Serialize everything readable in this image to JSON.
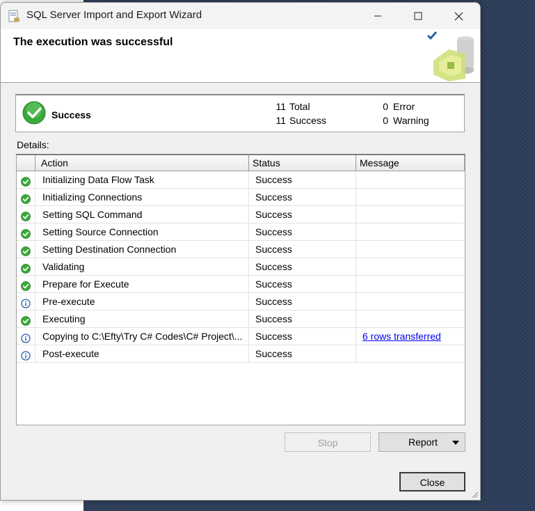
{
  "window": {
    "title": "SQL Server Import and Export Wizard"
  },
  "header": {
    "title": "The execution was successful"
  },
  "summary": {
    "status": "Success",
    "total_count": "11",
    "total_label": "Total",
    "success_count": "11",
    "success_label": "Success",
    "error_count": "0",
    "error_label": "Error",
    "warning_count": "0",
    "warning_label": "Warning"
  },
  "details_label": "Details:",
  "grid": {
    "columns": [
      "Action",
      "Status",
      "Message"
    ],
    "rows": [
      {
        "icon": "success-icon",
        "action": "Initializing Data Flow Task",
        "status": "Success",
        "message": ""
      },
      {
        "icon": "success-icon",
        "action": "Initializing Connections",
        "status": "Success",
        "message": ""
      },
      {
        "icon": "success-icon",
        "action": "Setting SQL Command",
        "status": "Success",
        "message": ""
      },
      {
        "icon": "success-icon",
        "action": "Setting Source Connection",
        "status": "Success",
        "message": ""
      },
      {
        "icon": "success-icon",
        "action": "Setting Destination Connection",
        "status": "Success",
        "message": ""
      },
      {
        "icon": "success-icon",
        "action": "Validating",
        "status": "Success",
        "message": ""
      },
      {
        "icon": "success-icon",
        "action": "Prepare for Execute",
        "status": "Success",
        "message": ""
      },
      {
        "icon": "info-icon",
        "action": "Pre-execute",
        "status": "Success",
        "message": ""
      },
      {
        "icon": "success-icon",
        "action": "Executing",
        "status": "Success",
        "message": ""
      },
      {
        "icon": "info-icon",
        "action": "Copying to C:\\Efty\\Try C# Codes\\C# Project\\...",
        "status": "Success",
        "message": "6 rows transferred"
      },
      {
        "icon": "info-icon",
        "action": "Post-execute",
        "status": "Success",
        "message": ""
      }
    ]
  },
  "buttons": {
    "stop": "Stop",
    "report": "Report",
    "close": "Close"
  },
  "colors": {
    "success_green": "#3aa93a",
    "info_blue": "#2a5da8",
    "link": "#0000ee"
  }
}
